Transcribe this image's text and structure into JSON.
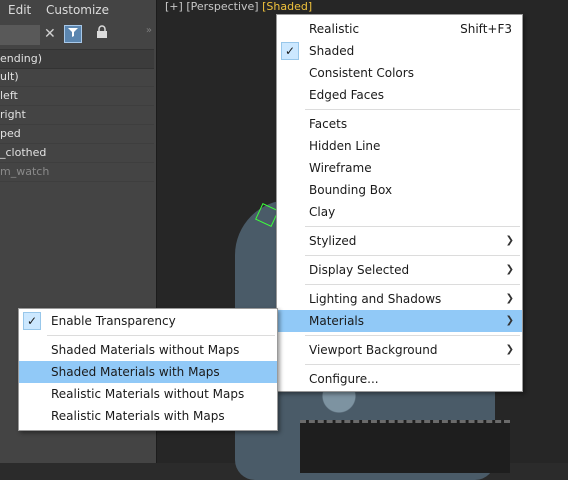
{
  "menubar": {
    "edit": "Edit",
    "customize": "Customize"
  },
  "toolbar": {
    "clear_icon": "close-icon",
    "filter_icon": "filter-icon",
    "lock_icon": "lock-icon",
    "more": "»"
  },
  "explorer": {
    "header": "ending)",
    "rows": [
      {
        "label": "ult)",
        "dim": false
      },
      {
        "label": "left",
        "dim": false
      },
      {
        "label": "right",
        "dim": false
      },
      {
        "label": "ped",
        "dim": false
      },
      {
        "label": "_clothed",
        "dim": false
      },
      {
        "label": "m_watch",
        "dim": true
      }
    ]
  },
  "viewport": {
    "plus": "[+]",
    "view": "[Perspective]",
    "shading": "[Shaded]"
  },
  "main_menu": {
    "realistic": "Realistic",
    "realistic_shortcut": "Shift+F3",
    "shaded": "Shaded",
    "consistent_colors": "Consistent Colors",
    "edged_faces": "Edged Faces",
    "facets": "Facets",
    "hidden_line": "Hidden Line",
    "wireframe": "Wireframe",
    "bounding_box": "Bounding Box",
    "clay": "Clay",
    "stylized": "Stylized",
    "display_selected": "Display Selected",
    "lighting_and_shadows": "Lighting and Shadows",
    "materials": "Materials",
    "viewport_background": "Viewport Background",
    "configure": "Configure..."
  },
  "sub_menu": {
    "enable_transparency": "Enable Transparency",
    "shaded_without_maps": "Shaded Materials without Maps",
    "shaded_with_maps": "Shaded Materials with Maps",
    "realistic_without_maps": "Realistic Materials without Maps",
    "realistic_with_maps": "Realistic Materials with Maps"
  },
  "colors": {
    "highlight": "#91c9f7",
    "shading_label": "#f0c23c",
    "check_bg": "#cce8ff"
  }
}
